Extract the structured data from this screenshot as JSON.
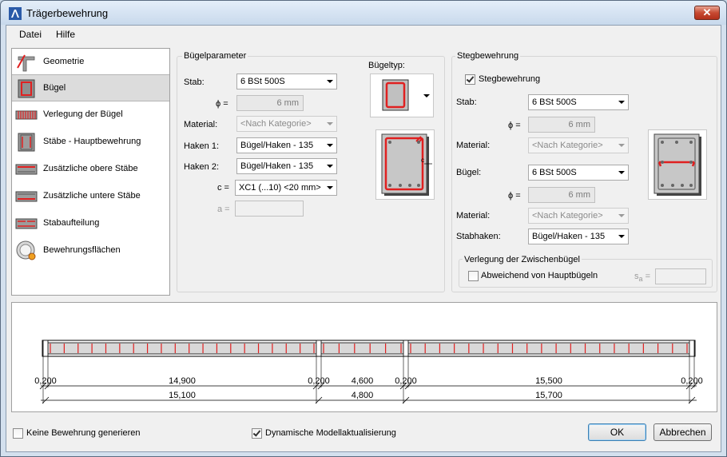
{
  "window": {
    "title": "Trägerbewehrung",
    "close_label": "✕"
  },
  "menu": {
    "items": [
      "Datei",
      "Hilfe"
    ]
  },
  "nav": {
    "items": [
      {
        "label": "Geometrie",
        "icon": "geometry-icon"
      },
      {
        "label": "Bügel",
        "icon": "stirrup-icon"
      },
      {
        "label": "Verlegung der Bügel",
        "icon": "stirrup-placement-icon"
      },
      {
        "label": "Stäbe - Hauptbewehrung",
        "icon": "main-bars-icon"
      },
      {
        "label": "Zusätzliche obere Stäbe",
        "icon": "top-bars-icon"
      },
      {
        "label": "Zusätzliche untere Stäbe",
        "icon": "bottom-bars-icon"
      },
      {
        "label": "Stabaufteilung",
        "icon": "bar-division-icon"
      },
      {
        "label": "Bewehrungsflächen",
        "icon": "reinforcement-area-icon"
      }
    ],
    "selected": 1
  },
  "buegel": {
    "title": "Bügelparameter",
    "stab_label": "Stab:",
    "stab_value": "6 BSt 500S",
    "phi_label": "ϕ =",
    "phi_value": "6 mm",
    "material_label": "Material:",
    "material_value": "<Nach Kategorie>",
    "haken1_label": "Haken 1:",
    "haken1_value": "Bügel/Haken - 135",
    "haken2_label": "Haken 2:",
    "haken2_value": "Bügel/Haken - 135",
    "c_label": "c =",
    "c_value": "XC1 (...10) <20 mm>",
    "a_label": "a =",
    "a_value": "",
    "typ_label": "Bügeltyp:"
  },
  "steg": {
    "title": "Stegbewehrung",
    "check_label": "Stegbewehrung",
    "checked": true,
    "stab_label": "Stab:",
    "stab_value": "6 BSt 500S",
    "phi_label": "ϕ =",
    "phi_value": "6 mm",
    "material_label": "Material:",
    "material_value": "<Nach Kategorie>",
    "buegel_label": "Bügel:",
    "buegel_value": "6 BSt 500S",
    "phi2_label": "ϕ =",
    "phi2_value": "6 mm",
    "material2_label": "Material:",
    "material2_value": "<Nach Kategorie>",
    "stabhaken_label": "Stabhaken:",
    "stabhaken_value": "Bügel/Haken - 135",
    "zwischen_title": "Verlegung der Zwischenbügel",
    "abweichend_label": "Abweichend von Hauptbügeln",
    "abweichend_checked": false,
    "sa_label": "s",
    "sa_sub": "a",
    "sa_eq": "=",
    "sa_value": ""
  },
  "beam": {
    "segments": [
      {
        "clear": "14,900",
        "total": "15,100"
      },
      {
        "clear": "4,600",
        "total": "4,800"
      },
      {
        "clear": "15,500",
        "total": "15,700"
      }
    ],
    "supports": [
      "0,200",
      "0,200",
      "0,200",
      "0,200"
    ],
    "stirrup_count": [
      19,
      5,
      19
    ]
  },
  "footer": {
    "keine_label": "Keine Bewehrung generieren",
    "keine_checked": false,
    "dyn_label": "Dynamische Modellaktualisierung",
    "dyn_checked": true,
    "ok_label": "OK",
    "cancel_label": "Abbrechen"
  },
  "colors": {
    "accent": "#e02020",
    "selection": "#dcdcdc"
  }
}
